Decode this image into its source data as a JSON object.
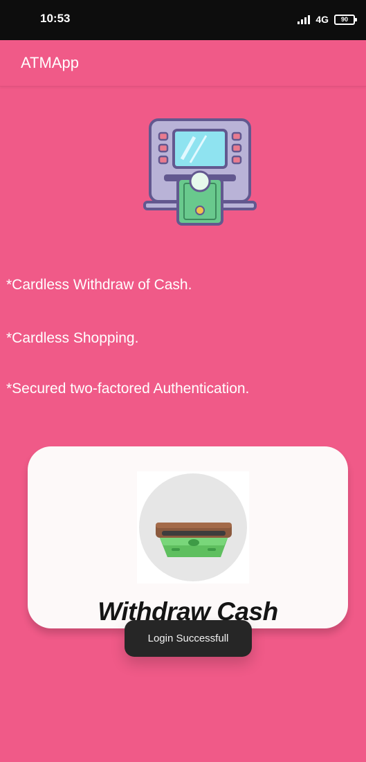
{
  "status_bar": {
    "time": "10:53",
    "network": "4G",
    "battery": "90"
  },
  "app_bar": {
    "title": "ATMApp"
  },
  "features": [
    "*Cardless Withdraw of Cash.",
    "*Cardless Shopping.",
    "*Secured two-factored Authentication."
  ],
  "withdraw_card": {
    "label": "Withdraw Cash",
    "icon": "cash-withdraw-icon"
  },
  "hero_icon": "atm-machine-icon",
  "toast": {
    "message": "Login Successfull"
  },
  "colors": {
    "background": "#f05a88",
    "status_bar": "#0d0d0d",
    "card": "#fdf9f9",
    "toast": "#262626",
    "money_green": "#5fbf5f"
  }
}
